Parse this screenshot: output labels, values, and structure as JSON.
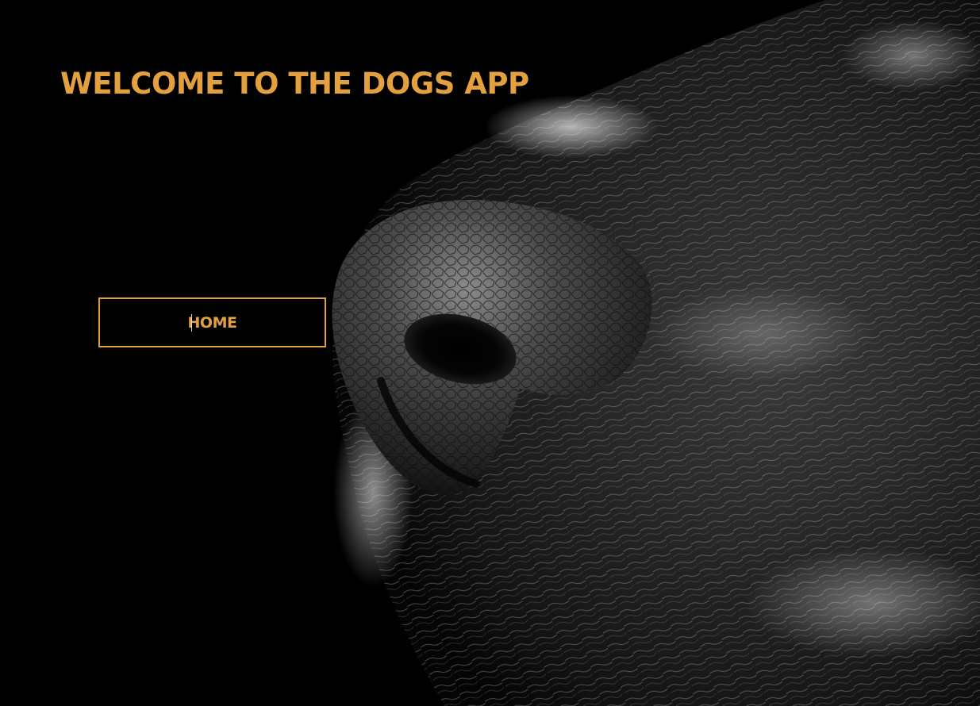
{
  "hero": {
    "image": "black-and-white close-up of a dog's nose"
  },
  "header": {
    "title": "WELCOME TO THE DOGS APP"
  },
  "nav": {
    "home_label": "HOME"
  },
  "colors": {
    "accent": "#e3a03e",
    "background": "#000000"
  }
}
